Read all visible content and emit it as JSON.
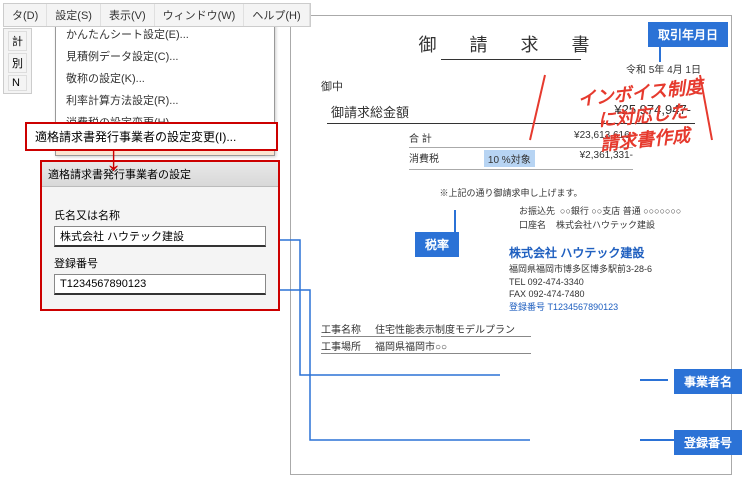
{
  "menubar": {
    "items": [
      "タ(D)",
      "設定(S)",
      "表示(V)",
      "ウィンドウ(W)",
      "ヘルプ(H)"
    ]
  },
  "dropdown": {
    "items": [
      "かんたんシート設定(E)...",
      "見積例データ設定(C)...",
      "敬称の設定(K)...",
      "利率計算方法設定(R)...",
      "消費税の設定変更(H)...",
      "適格請求書発行事業者の設定変更(I)..."
    ]
  },
  "crumbs": {
    "a": "計",
    "b": "別",
    "c": "N"
  },
  "redbox": {
    "label": "適格請求書発行事業者の設定変更(I)..."
  },
  "dialog": {
    "title": "適格請求書発行事業者の設定",
    "name_label": "氏名又は名称",
    "name_value": "株式会社 ハウテック建設",
    "reg_label": "登録番号",
    "reg_value": "T1234567890123"
  },
  "invoice": {
    "title": "御 請 求 書",
    "date": "令和 5年 4月 1日",
    "recipient": "御中",
    "total_label": "御請求総金額",
    "total_value": "¥25,974,947-",
    "sum_label": "合 計",
    "sum_value": "¥23,613,616-",
    "tax_label": "消費税",
    "tax_rate": "10 %対象",
    "tax_value": "¥2,361,331-",
    "note": "※上記の通り御請求申し上げます。",
    "bank_label": "お振込先",
    "bank_value": "○○銀行 ○○支店 普通 ○○○○○○○",
    "acct_label": "口座名",
    "acct_value": "株式会社ハウテック建設",
    "company": "株式会社 ハウテック建設",
    "addr1": "福岡県福岡市博多区博多駅前3-28-6",
    "tel": "TEL 092-474-3340",
    "fax": "FAX 092-474-7480",
    "reg_label": "登録番号",
    "reg_value": "T1234567890123",
    "work_name_label": "工事名称",
    "work_name": "住宅性能表示制度モデルプラン",
    "work_loc_label": "工事場所",
    "work_loc": "福岡県福岡市○○"
  },
  "badges": {
    "date": "取引年月日",
    "rate": "税率",
    "company": "事業者名",
    "reg": "登録番号"
  },
  "callout": {
    "l1": "インボイス制度",
    "l2": "に対応した",
    "l3": "請求書作成"
  },
  "colors": {
    "accent": "#2b72d6",
    "alert": "#c00",
    "callout": "#e63a2e"
  }
}
